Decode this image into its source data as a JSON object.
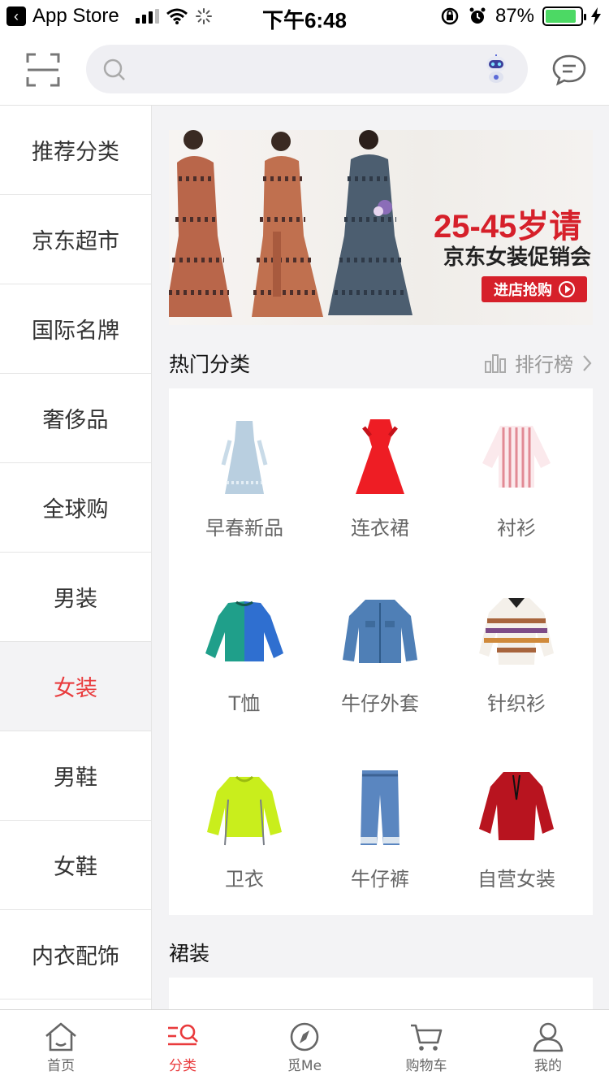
{
  "status_bar": {
    "back_app": "App Store",
    "time": "下午6:48",
    "battery_percent": "87%",
    "battery_level": 0.87
  },
  "search": {
    "placeholder": "",
    "scan_icon": "scan-icon",
    "assistant_icon": "jd-robot-icon",
    "message_icon": "message-icon"
  },
  "sidebar": {
    "items": [
      {
        "label": "推荐分类",
        "active": false
      },
      {
        "label": "京东超市",
        "active": false
      },
      {
        "label": "国际名牌",
        "active": false
      },
      {
        "label": "奢侈品",
        "active": false
      },
      {
        "label": "全球购",
        "active": false
      },
      {
        "label": "男装",
        "active": false
      },
      {
        "label": "女装",
        "active": true
      },
      {
        "label": "男鞋",
        "active": false
      },
      {
        "label": "女鞋",
        "active": false
      },
      {
        "label": "内衣配饰",
        "active": false
      }
    ]
  },
  "banner": {
    "title": "25-45岁请",
    "subtitle": "京东女装促销会",
    "button": "进店抢购"
  },
  "hot": {
    "title": "热门分类",
    "rank_label": "排行榜",
    "items": [
      {
        "label": "早春新品",
        "icon": "light-blue-dress-icon",
        "color": "#b9cfe0"
      },
      {
        "label": "连衣裙",
        "icon": "red-dress-icon",
        "color": "#ee1d24"
      },
      {
        "label": "衬衫",
        "icon": "striped-blouse-icon",
        "color": "#e28a95"
      },
      {
        "label": "T恤",
        "icon": "green-blue-sweatshirt-icon",
        "color": "#1f9f8a"
      },
      {
        "label": "牛仔外套",
        "icon": "denim-jacket-icon",
        "color": "#4f7fb6"
      },
      {
        "label": "针织衫",
        "icon": "striped-knit-icon",
        "color": "#a8653d"
      },
      {
        "label": "卫衣",
        "icon": "neon-hoodie-icon",
        "color": "#c9ee1c"
      },
      {
        "label": "牛仔裤",
        "icon": "jeans-icon",
        "color": "#5a86c0"
      },
      {
        "label": "自营女装",
        "icon": "red-blouse-icon",
        "color": "#b8141f"
      }
    ]
  },
  "section2": {
    "title": "裙装"
  },
  "tabbar": {
    "items": [
      {
        "label": "首页",
        "icon": "home-icon",
        "active": false
      },
      {
        "label": "分类",
        "icon": "category-icon",
        "active": true
      },
      {
        "label": "觅Me",
        "icon": "compass-icon",
        "active": false
      },
      {
        "label": "购物车",
        "icon": "cart-icon",
        "active": false
      },
      {
        "label": "我的",
        "icon": "user-icon",
        "active": false
      }
    ]
  },
  "colors": {
    "accent": "#e93b3d",
    "banner_red": "#d6202a"
  }
}
